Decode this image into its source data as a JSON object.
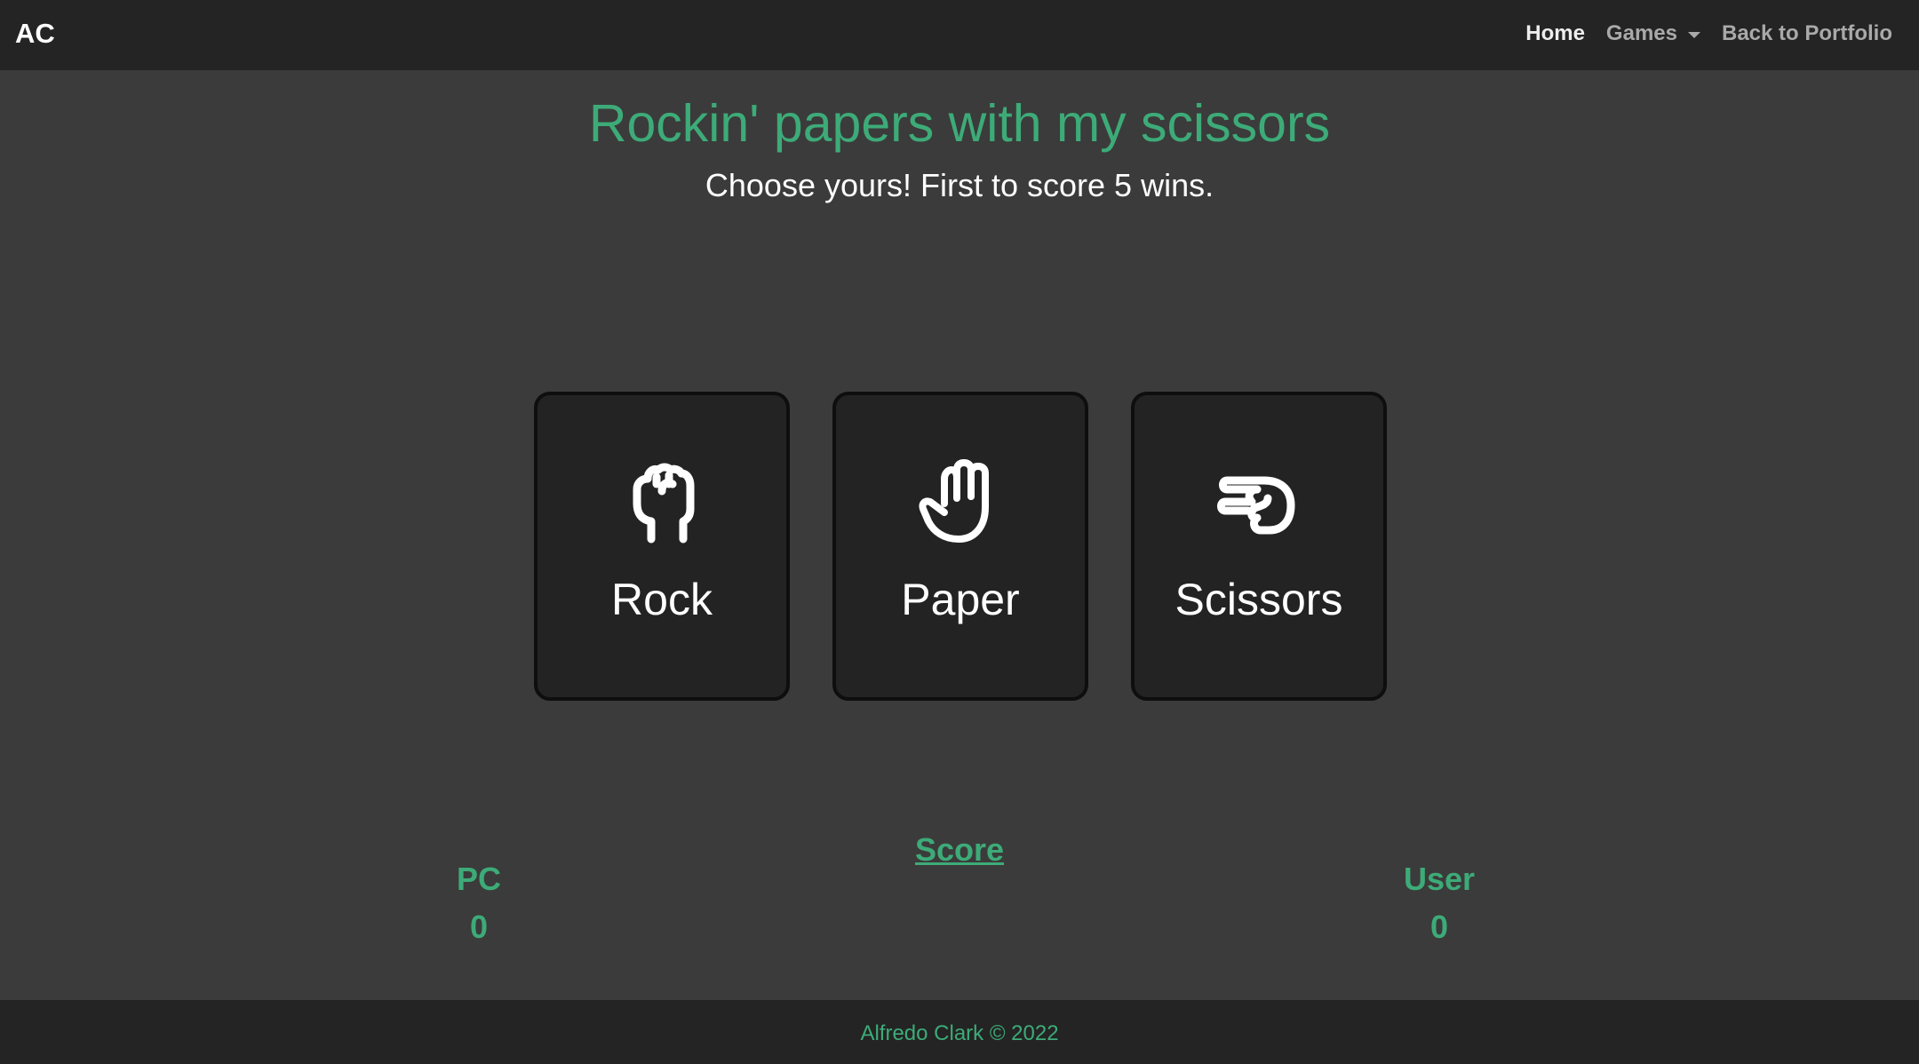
{
  "navbar": {
    "brand": "AC",
    "links": [
      {
        "label": "Home"
      },
      {
        "label": "Games"
      },
      {
        "label": "Back to Portfolio"
      }
    ]
  },
  "header": {
    "title": "Rockin' papers with my scissors",
    "subtitle": "Choose yours! First to score 5 wins."
  },
  "choices": [
    {
      "label": "Rock",
      "icon": "fist-icon"
    },
    {
      "label": "Paper",
      "icon": "open-hand-icon"
    },
    {
      "label": "Scissors",
      "icon": "scissors-hand-icon"
    }
  ],
  "score": {
    "title": "Score",
    "pc": {
      "label": "PC",
      "value": "0"
    },
    "user": {
      "label": "User",
      "value": "0"
    }
  },
  "footer": {
    "text": "Alfredo Clark © 2022"
  },
  "colors": {
    "accent": "#3dab78",
    "background": "#3b3b3b",
    "navbar": "#242424",
    "card": "#232323"
  }
}
